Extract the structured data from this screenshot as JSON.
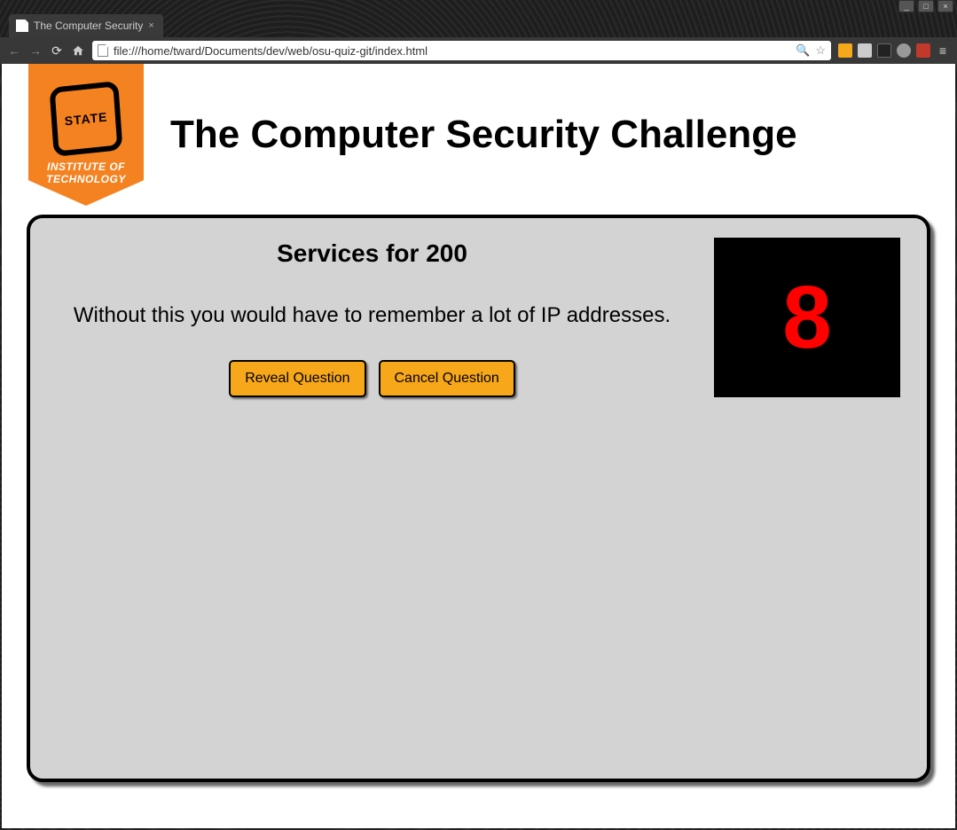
{
  "window": {
    "minimize": "_",
    "maximize": "□",
    "close": "×"
  },
  "tab": {
    "title": "The Computer Security",
    "close": "×"
  },
  "address": {
    "url": "file:///home/tward/Documents/dev/web/osu-quiz-git/index.html"
  },
  "logo": {
    "mark": "STATE",
    "line1": "INSTITUTE OF",
    "line2": "TECHNOLOGY"
  },
  "header": {
    "title": "The Computer Security Challenge"
  },
  "game": {
    "category": "Services for 200",
    "clue": "Without this you would have to remember a lot of IP addresses.",
    "reveal_label": "Reveal Question",
    "cancel_label": "Cancel Question",
    "timer": "8"
  }
}
